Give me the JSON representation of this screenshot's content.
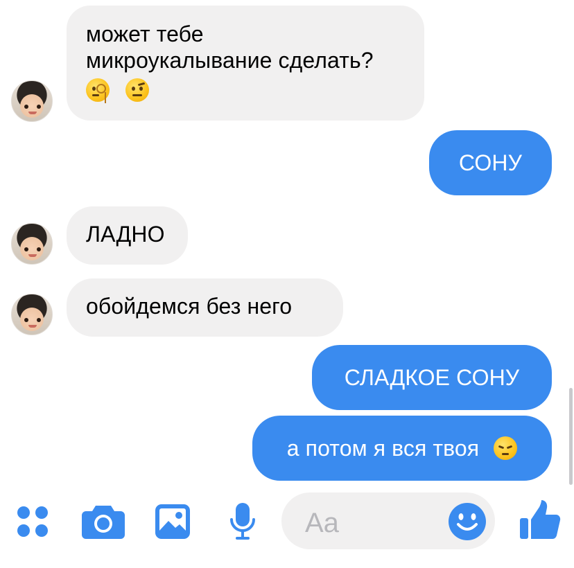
{
  "messages": [
    {
      "side": "incoming",
      "text": "может тебе\nмикроукалывание сделать?",
      "emojis": [
        "face-with-monocle-emoji",
        "face-with-raised-eyebrow-emoji"
      ]
    },
    {
      "side": "outgoing",
      "text": "СОНУ"
    },
    {
      "side": "incoming",
      "text": "ЛАДНО"
    },
    {
      "side": "incoming",
      "text": "обойдемся без него"
    },
    {
      "side": "outgoing",
      "text": "СЛАДКОЕ СОНУ"
    },
    {
      "side": "outgoing",
      "text": "а потом я вся твоя",
      "emoji": "pensive-face-emoji"
    }
  ],
  "composer": {
    "placeholder": "Aa",
    "icons": [
      "apps-icon",
      "camera-icon",
      "gallery-icon",
      "microphone-icon",
      "emoji-icon",
      "thumbs-up-icon"
    ]
  },
  "colors": {
    "outgoing_bubble": "#3a8bef",
    "incoming_bubble": "#f1f0f0",
    "accent_icon": "#3a8bef",
    "placeholder_text": "#b7b7bb"
  }
}
